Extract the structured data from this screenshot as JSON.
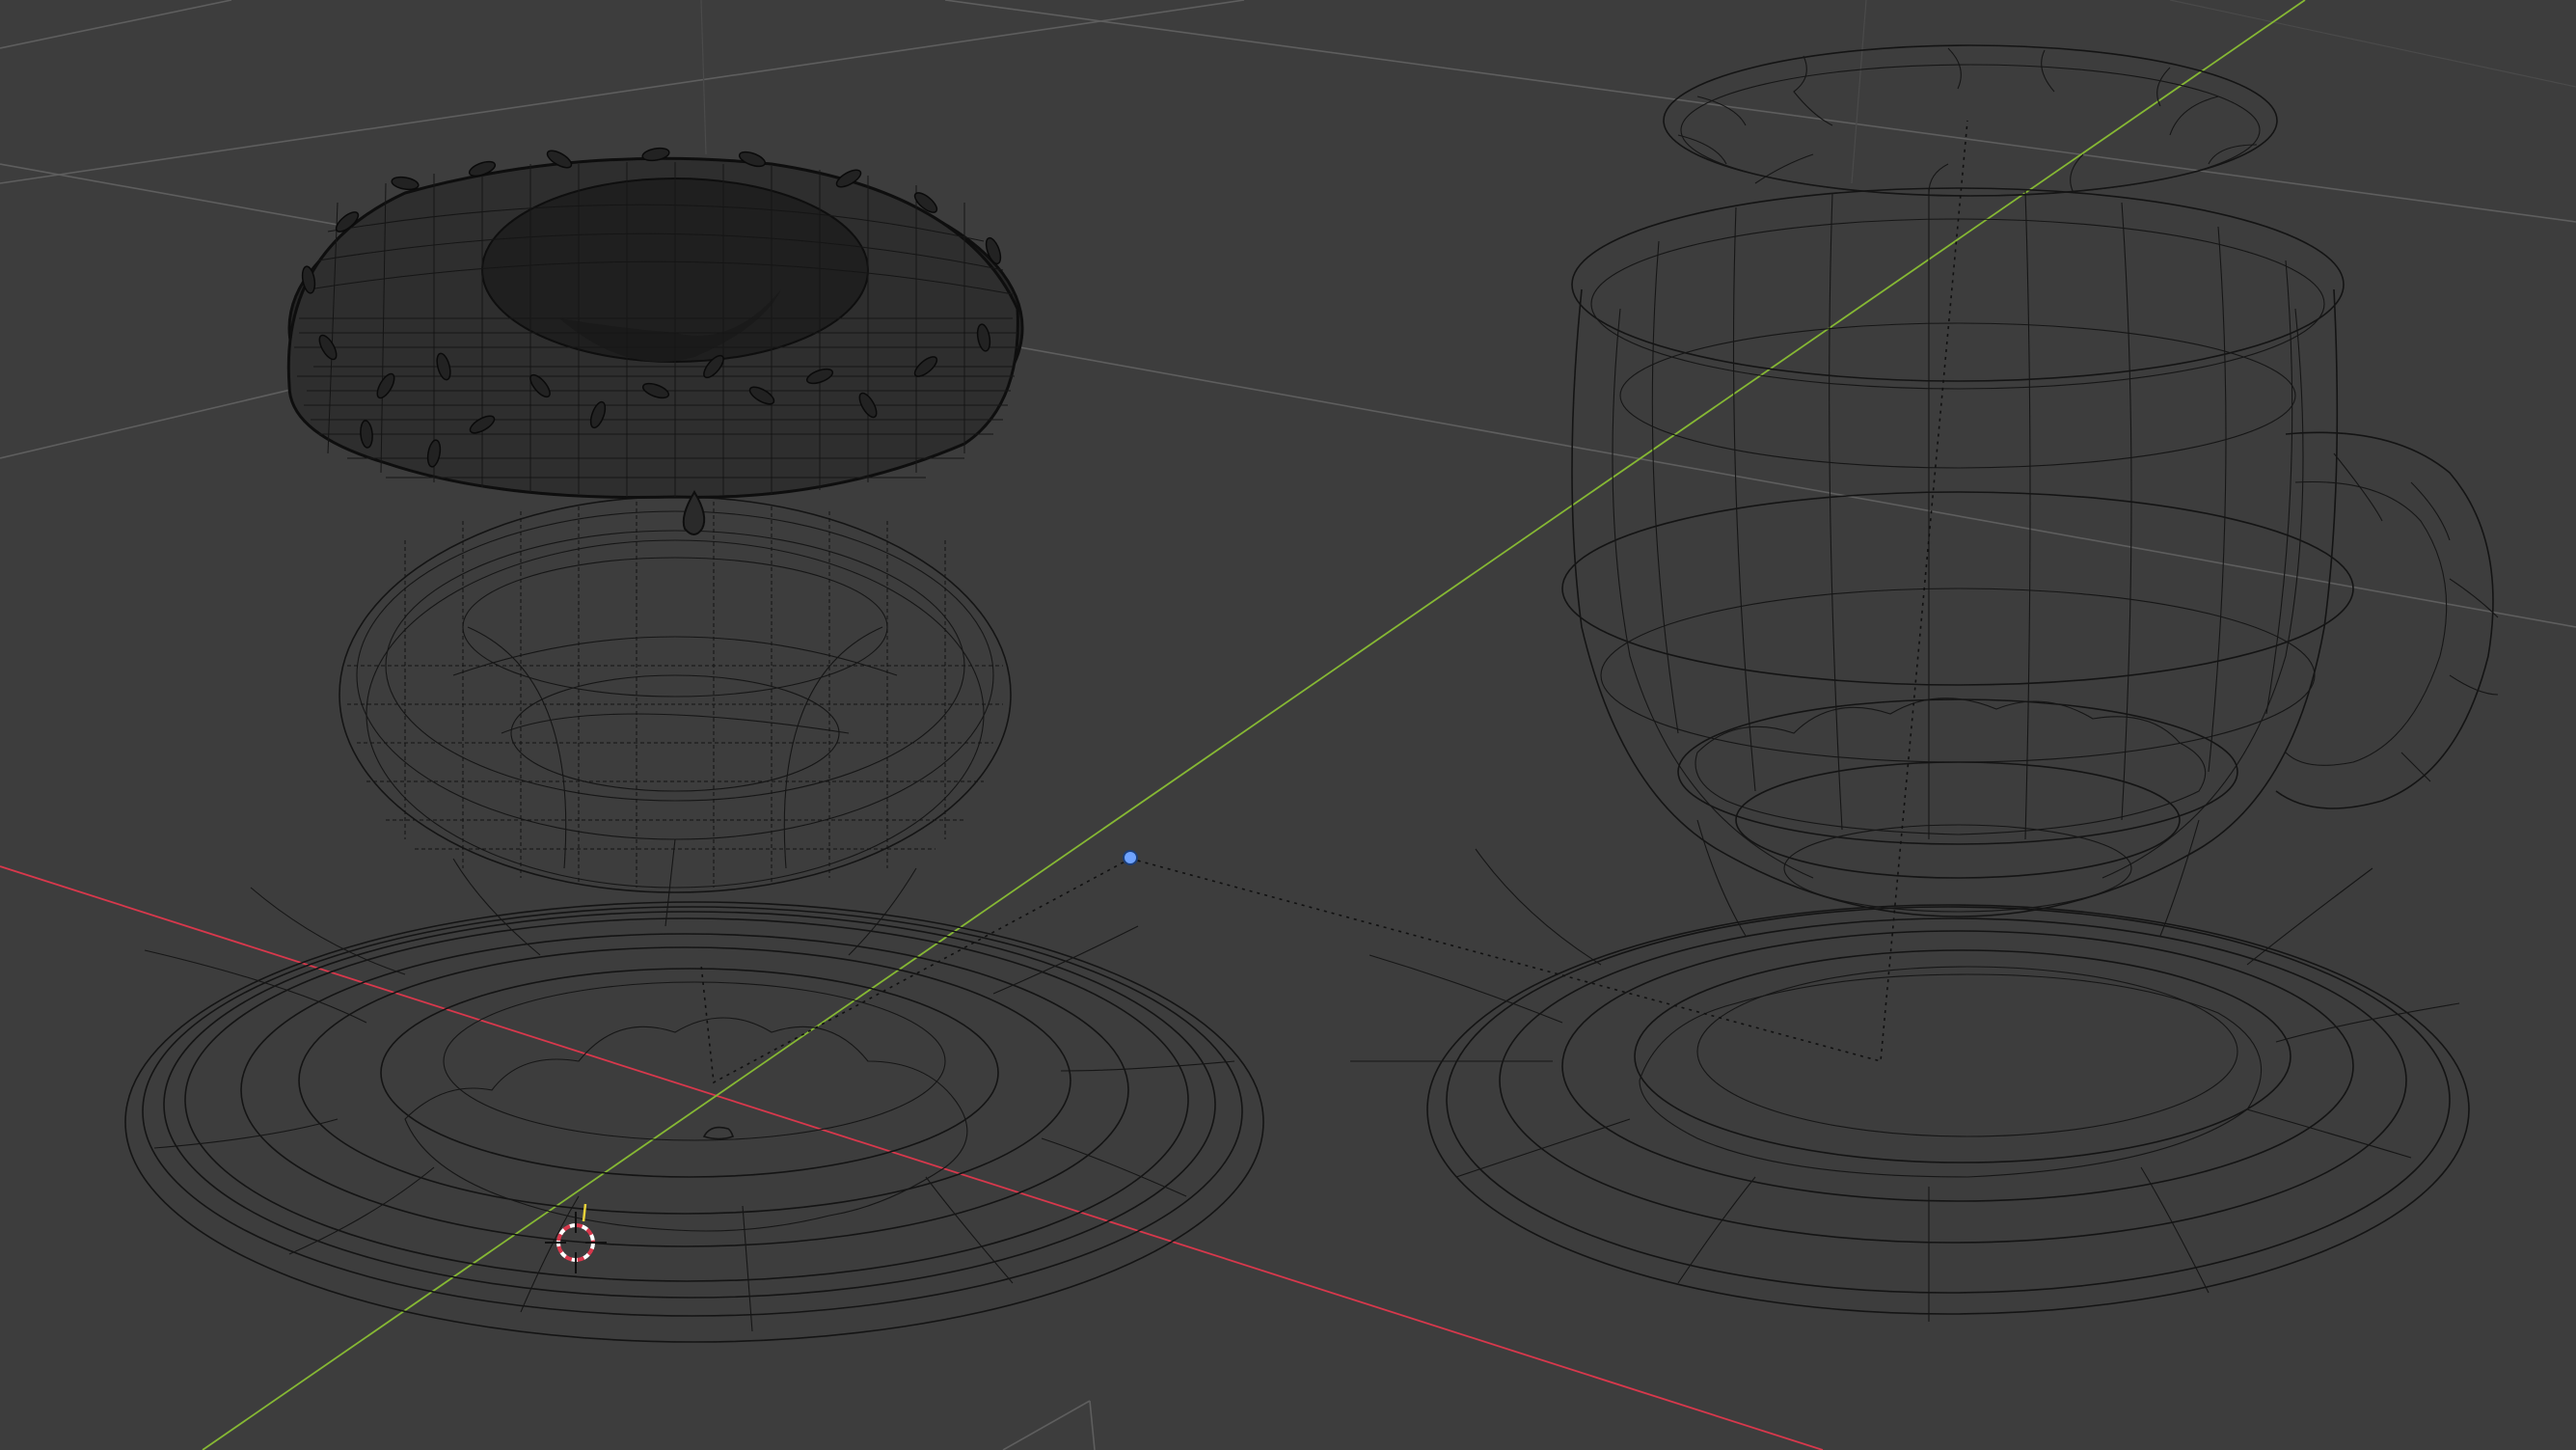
{
  "viewport": {
    "mode": "wireframe",
    "background_color": "#3d3d3d",
    "grid_color": "#5e5e5e",
    "x_axis_color": "#d8384c",
    "y_axis_color": "#86b834",
    "wire_color": "#141414",
    "light_dot_color": "#6fa3ff"
  },
  "objects": [
    {
      "name": "donut-icing"
    },
    {
      "name": "donut"
    },
    {
      "name": "plate-left"
    },
    {
      "name": "cup"
    },
    {
      "name": "saucer-top"
    },
    {
      "name": "saucer-right"
    },
    {
      "name": "light"
    },
    {
      "name": "3d-cursor"
    }
  ]
}
